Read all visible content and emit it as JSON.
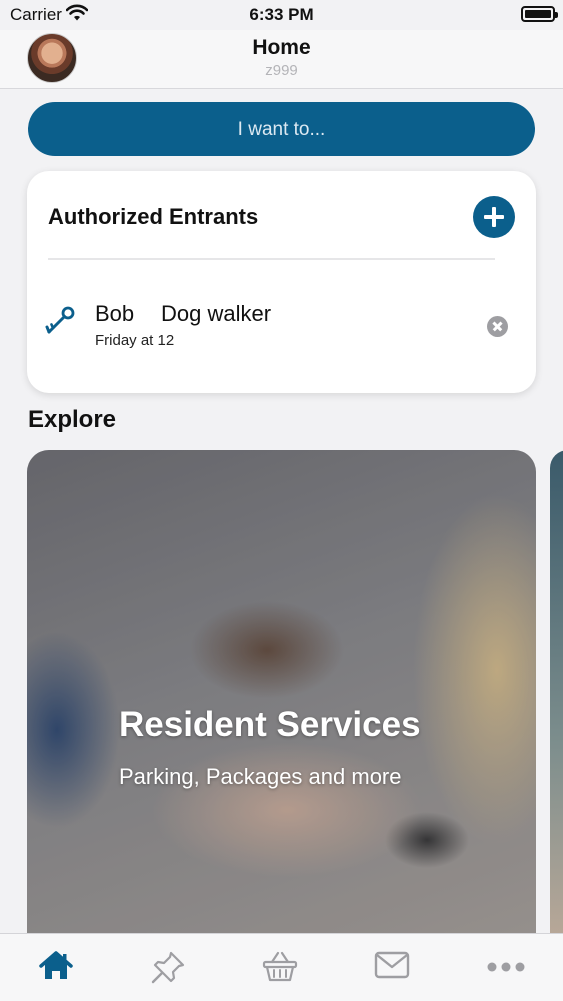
{
  "status_bar": {
    "carrier": "Carrier",
    "time": "6:33 PM"
  },
  "header": {
    "title": "Home",
    "subtitle": "z999"
  },
  "action_button": {
    "label": "I want to..."
  },
  "authorized_entrants": {
    "title": "Authorized Entrants",
    "items": [
      {
        "name": "Bob",
        "role": "Dog walker",
        "schedule": "Friday at 12"
      }
    ]
  },
  "explore": {
    "title": "Explore",
    "cards": [
      {
        "title": "Resident Services",
        "subtitle": "Parking, Packages and more"
      }
    ]
  },
  "tab_bar": {
    "tabs": [
      {
        "icon": "home-icon",
        "active": true
      },
      {
        "icon": "pin-icon",
        "active": false
      },
      {
        "icon": "basket-icon",
        "active": false
      },
      {
        "icon": "mail-icon",
        "active": false
      },
      {
        "icon": "more-icon",
        "active": false
      }
    ]
  },
  "colors": {
    "accent": "#0b5f8c",
    "inactive_icon": "#9e9ea2",
    "background": "#f2f2f4"
  }
}
